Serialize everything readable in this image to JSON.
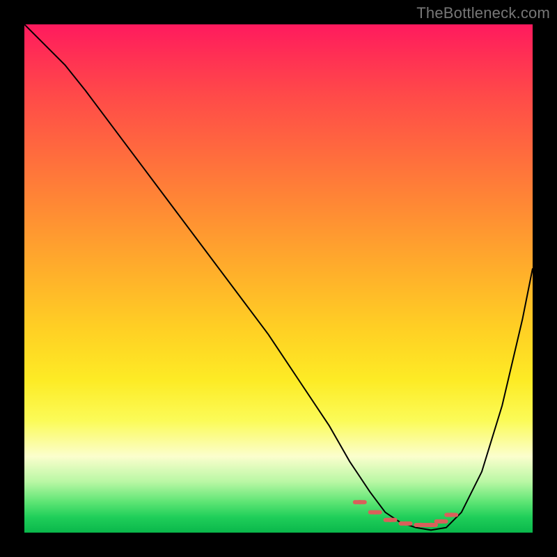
{
  "watermark": "TheBottleneck.com",
  "colors": {
    "frame": "#000000",
    "curve": "#000000",
    "marker": "#d9605a",
    "gradient_stops": [
      "#ff1a5e",
      "#ff4a49",
      "#ff8a34",
      "#ffd024",
      "#fbfb58",
      "#fbfecd",
      "#5de574",
      "#0ab84b"
    ]
  },
  "chart_data": {
    "type": "line",
    "title": "",
    "xlabel": "",
    "ylabel": "",
    "xlim": [
      0,
      100
    ],
    "ylim": [
      0,
      100
    ],
    "x": [
      0,
      4,
      8,
      12,
      18,
      24,
      30,
      36,
      42,
      48,
      54,
      60,
      64,
      68,
      71,
      74,
      77,
      80,
      83,
      86,
      90,
      94,
      98,
      100
    ],
    "values": [
      100,
      96,
      92,
      87,
      79,
      71,
      63,
      55,
      47,
      39,
      30,
      21,
      14,
      8,
      4,
      2,
      1,
      0.5,
      1,
      4,
      12,
      25,
      42,
      52
    ],
    "markers": {
      "note": "flat-bottom red dashed segment near the trough",
      "x": [
        66,
        69,
        72,
        75,
        78,
        80,
        82,
        84
      ],
      "y": [
        6,
        4,
        2.5,
        1.8,
        1.5,
        1.5,
        2.2,
        3.5
      ]
    }
  }
}
